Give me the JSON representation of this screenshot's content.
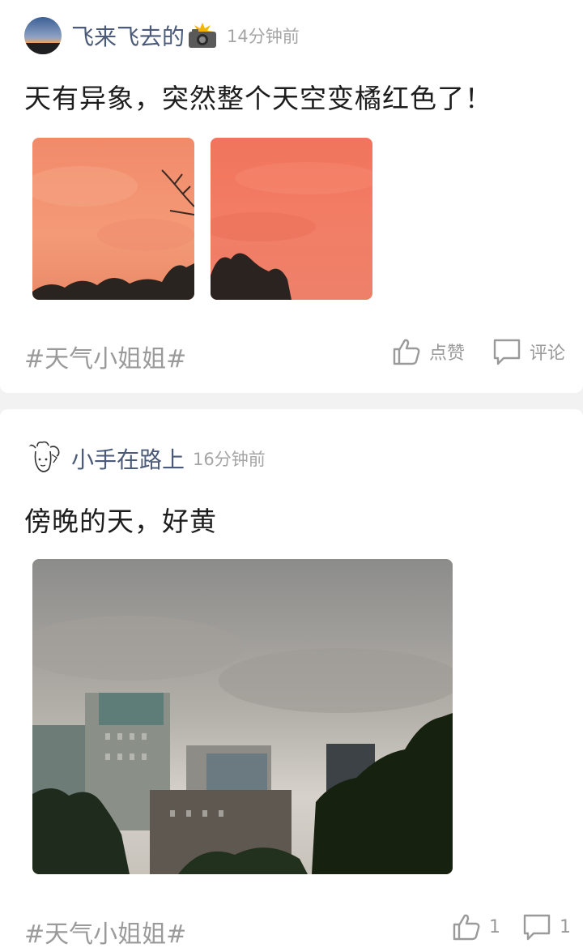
{
  "posts": [
    {
      "username": "飞来飞去的",
      "time": "14分钟前",
      "text": "天有异象，突然整个天空变橘红色了！",
      "tag": "#天气小姐姐#",
      "like_label": "点赞",
      "comment_label": "评论",
      "username_emoji": "camera-flash-icon"
    },
    {
      "username": "小手在路上",
      "time": "16分钟前",
      "text": "傍晚的天，好黄",
      "tag": "#天气小姐姐#",
      "like_count": "1",
      "comment_count": "1"
    }
  ],
  "colors": {
    "username": "#4a5a78",
    "muted": "#9a9a9a",
    "text": "#1d1d1d",
    "card_bg": "#ffffff",
    "page_bg": "#f2f2f2"
  }
}
